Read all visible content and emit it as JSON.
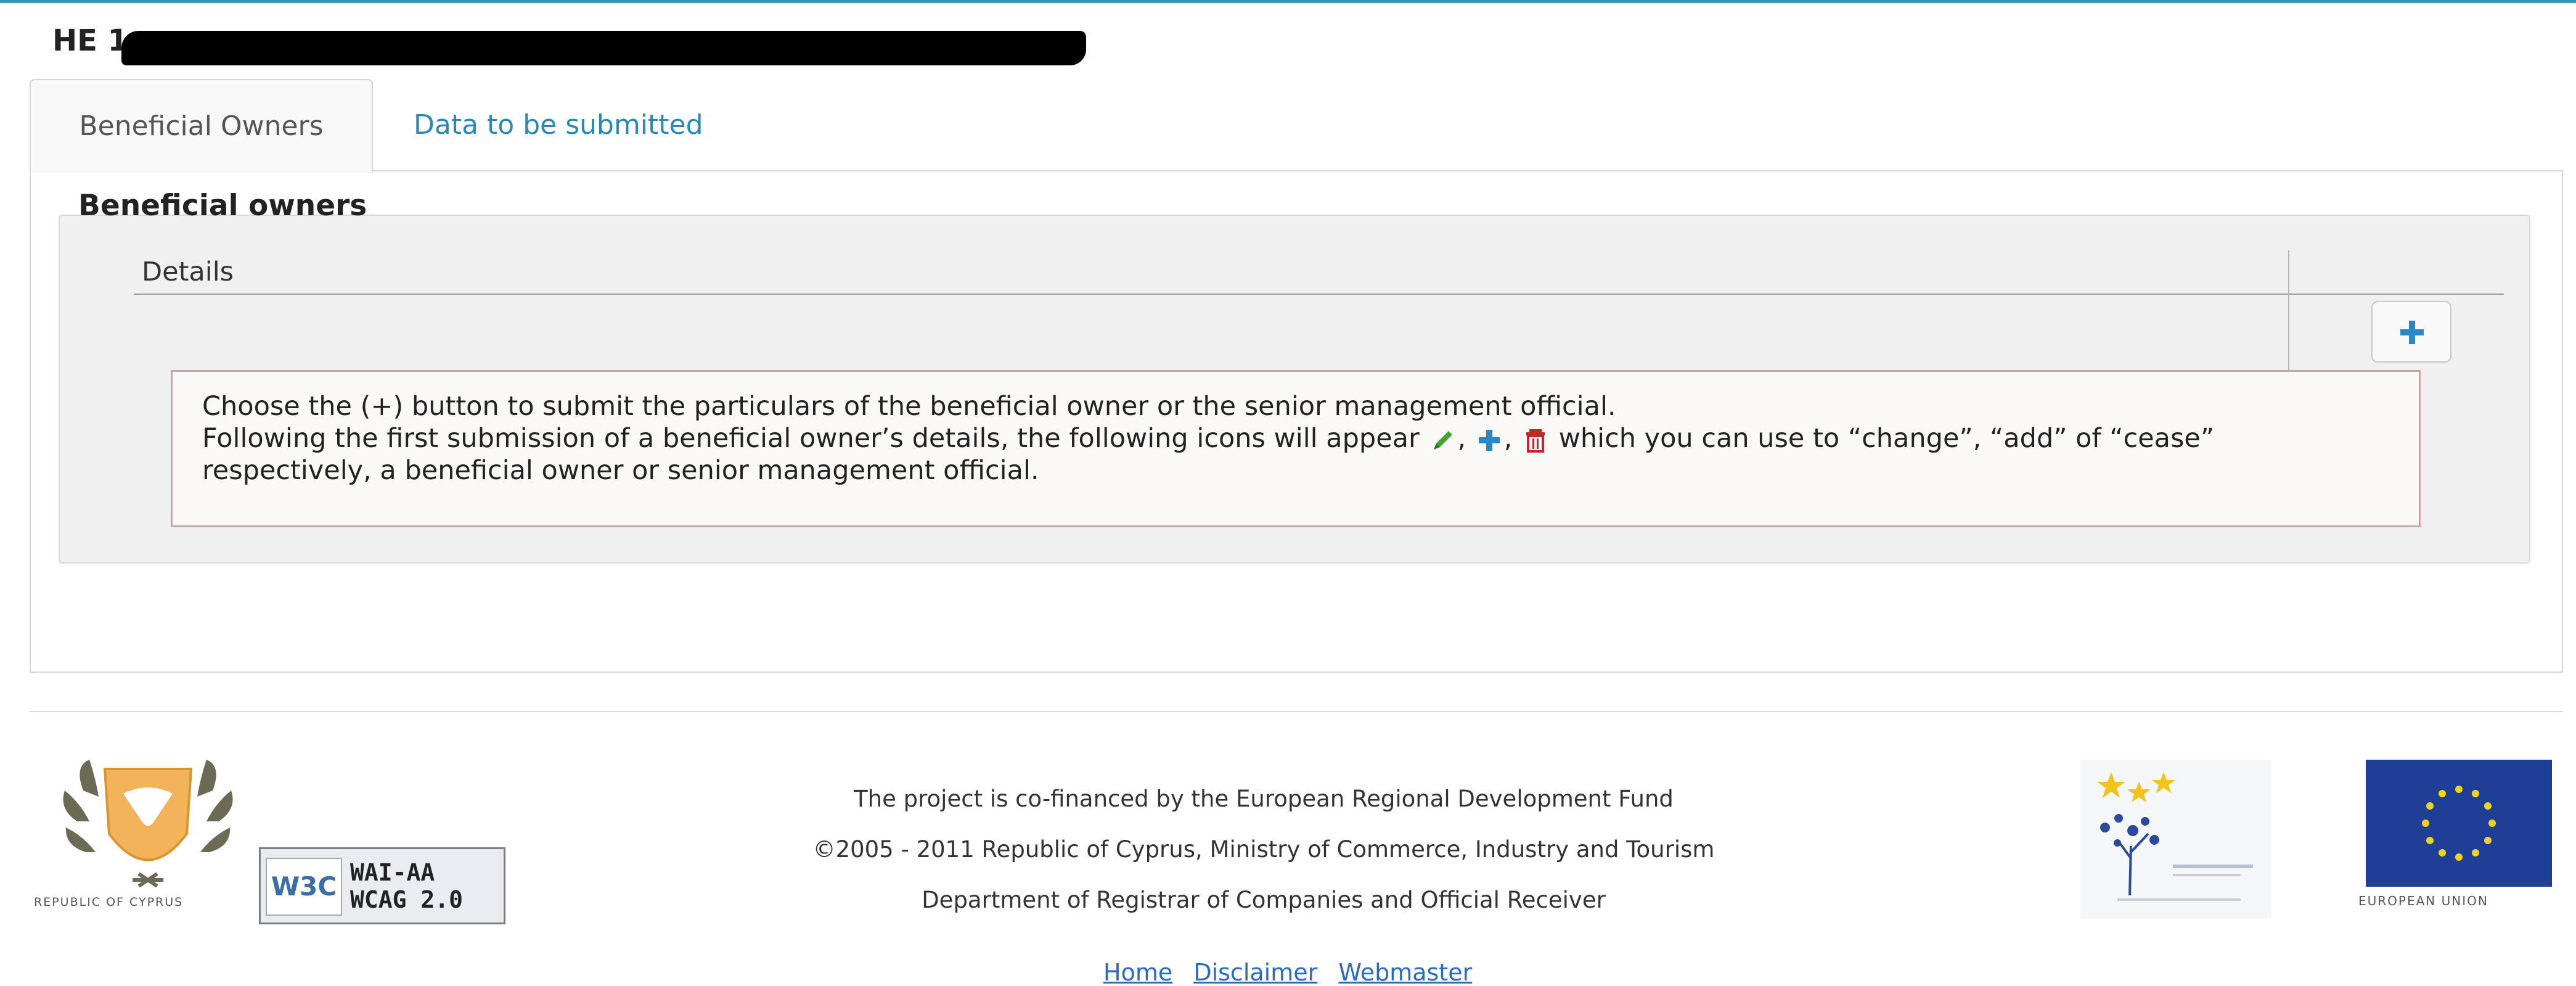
{
  "header": {
    "company_code": "HE 1",
    "redacted": true
  },
  "tabs": [
    {
      "label": "Beneficial Owners",
      "active": true
    },
    {
      "label": "Data to be submitted",
      "active": false
    }
  ],
  "beneficial_owners": {
    "legend": "Beneficial owners",
    "details_header": "Details",
    "add_button_icon": "plus-icon",
    "info": {
      "line1": "Choose the (+) button to submit the particulars of the beneficial owner or the senior management official.",
      "line2_before_icons": "Following the first submission of a beneficial owner’s details, the following icons will appear",
      "sep1": ",",
      "sep2": ",",
      "line2_after_icons": " which you can use to “change”, “add” of “cease” respectively, a beneficial owner or senior management official.",
      "icons": [
        "pencil-icon",
        "plus-icon",
        "trash-icon"
      ]
    }
  },
  "footer": {
    "emblem_caption": "REPUBLIC OF CYPRUS",
    "w3c_logo": "W3C",
    "w3c_badge": "WAI-AA\nWCAG 2.0",
    "line1": "The project is co-financed by the European Regional Development Fund",
    "line2": "©2005 - 2011 Republic of Cyprus, Ministry of Commerce, Industry and Tourism",
    "line3": "Department of Registrar of Companies and Official Receiver",
    "eu_caption": "EUROPEAN UNION",
    "links": [
      "Home",
      "Disclaimer",
      "Webmaster"
    ]
  },
  "colors": {
    "accent": "#3a93b4",
    "link": "#2a88b6",
    "plus": "#2a88c9",
    "pencil": "#3fa52f",
    "trash": "#c0272d",
    "eu_blue": "#1f3f97"
  }
}
